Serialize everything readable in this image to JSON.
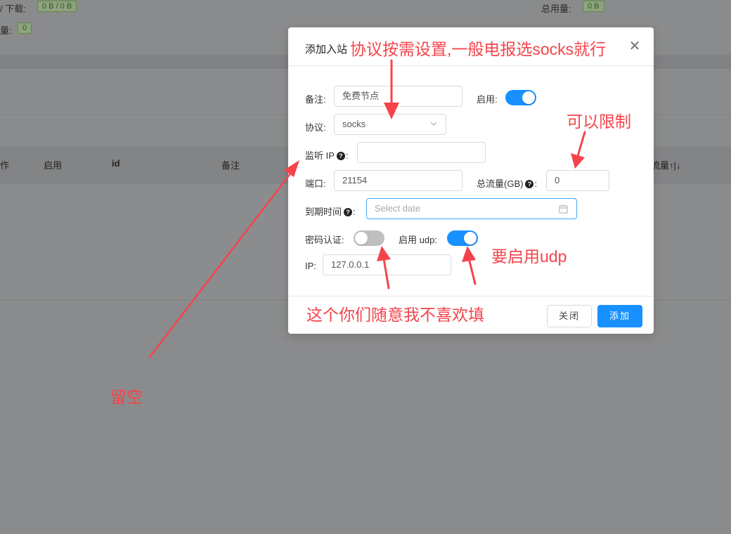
{
  "background": {
    "upload_download_label": "/ 下载:",
    "upload_download_value": "0 B / 0 B",
    "total_usage_label": "总用量:",
    "total_usage_value": "0 B",
    "count_label": "量:",
    "count_value": "0",
    "table_headers": [
      "作",
      "启用",
      "id",
      "备注",
      "流量↑|↓"
    ]
  },
  "modal": {
    "title": "添加入站",
    "close_icon": "close-icon",
    "fields": {
      "remark_label": "备注:",
      "remark_value": "免费节点",
      "enable_label": "启用:",
      "enable_on": true,
      "protocol_label": "协议:",
      "protocol_value": "socks",
      "listen_ip_label": "监听 IP",
      "listen_ip_value": "",
      "port_label": "端口:",
      "port_value": "21154",
      "total_traffic_label": "总流量(GB)",
      "total_traffic_value": "0",
      "expire_label": "到期时间",
      "expire_placeholder": "Select date",
      "password_auth_label": "密码认证:",
      "password_auth_on": false,
      "udp_label": "启用 udp:",
      "udp_on": true,
      "ip_label": "IP:",
      "ip_value": "127.0.0.1"
    },
    "colon": ":",
    "buttons": {
      "close": "关闭",
      "add": "添加"
    }
  },
  "annotations": {
    "protocol_note": "协议按需设置,一般电报选socks就行",
    "limit_note": "可以限制",
    "udp_note": "要启用udp",
    "freeform_note": "这个你们随意我不喜欢填",
    "leave_empty_note": "留空"
  },
  "colors": {
    "accent": "#1890ff",
    "annotation": "#f5434b",
    "overlay": "#8a8b8c"
  }
}
